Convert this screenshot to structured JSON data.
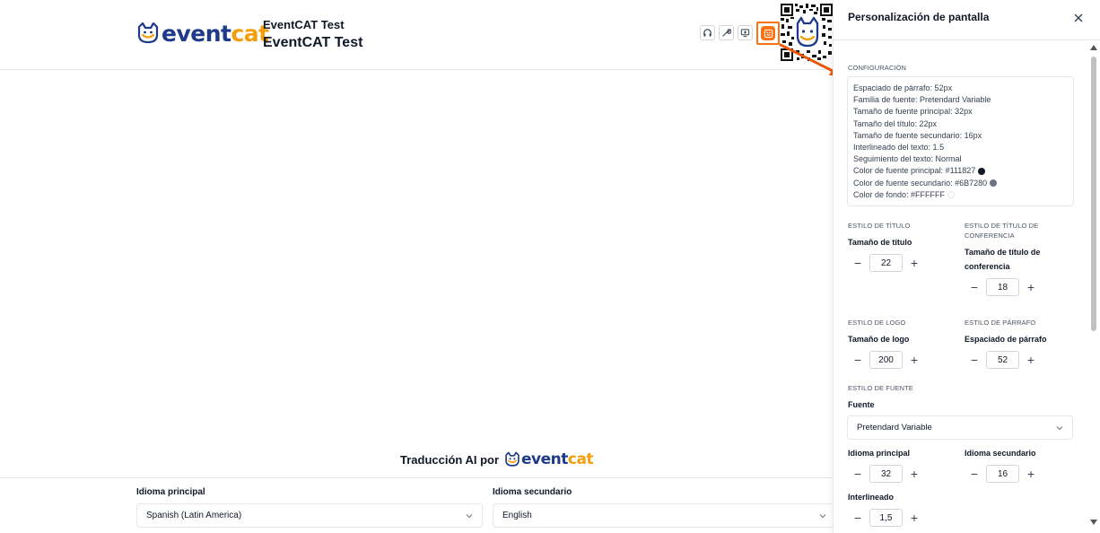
{
  "header": {
    "logo_text_part1": "event",
    "logo_text_part2": "cat",
    "event_name_small": "EventCAT Test",
    "event_name_large": "EventCAT Test",
    "icons": [
      "headphones-icon",
      "wrench-icon",
      "screen-download-icon",
      "screen-customize-icon"
    ],
    "accent_color": "#f97316"
  },
  "translation": {
    "powered_by": "Traducción AI por",
    "logo_text_part1": "event",
    "logo_text_part2": "cat",
    "primary_language_label": "Idioma principal",
    "primary_language_value": "Spanish (Latin America)",
    "secondary_language_label": "Idioma secundario",
    "secondary_language_value": "English"
  },
  "panel": {
    "title": "Personalización de pantalla",
    "config_section": "CONFIGURACIÓN",
    "config_lines": [
      {
        "text": "Espaciado de párrafo: 52px",
        "dot": null
      },
      {
        "text": "Familia de fuente: Pretendard Variable",
        "dot": null
      },
      {
        "text": "Tamaño de fuente principal: 32px",
        "dot": null
      },
      {
        "text": "Tamaño del título: 22px",
        "dot": null
      },
      {
        "text": "Tamaño de fuente secundario: 16px",
        "dot": null
      },
      {
        "text": "Interlineado del texto: 1.5",
        "dot": null
      },
      {
        "text": "Seguimiento del texto: Normal",
        "dot": null
      },
      {
        "text": "Color de fuente principal: #111827",
        "dot": "#111827"
      },
      {
        "text": "Color de fuente secundario: #6B7280",
        "dot": "#6B7280"
      },
      {
        "text": "Color de fondo: #FFFFFF",
        "dot": "#FFFFFF"
      }
    ],
    "title_style_section": "ESTILO DE TÍTULO",
    "title_size_label": "Tamaño de título",
    "title_size_value": "22",
    "conf_title_section_line1": "ESTILO DE TÍTULO DE",
    "conf_title_section_line2": "CONFERENCIA",
    "conf_title_size_label_line1": "Tamaño de título de",
    "conf_title_size_label_line2": "conferencia",
    "conf_title_size_value": "18",
    "logo_style_section": "ESTILO DE LOGO",
    "logo_size_label": "Tamaño de logo",
    "logo_size_value": "200",
    "paragraph_style_section": "ESTILO DE PÁRRAFO",
    "paragraph_spacing_label": "Espaciado de párrafo",
    "paragraph_spacing_value": "52",
    "font_style_section": "ESTILO DE FUENTE",
    "font_label": "Fuente",
    "font_value": "Pretendard Variable",
    "primary_lang_label": "Idioma principal",
    "primary_lang_value": "32",
    "secondary_lang_label": "Idioma secundario",
    "secondary_lang_value": "16",
    "line_height_label": "Interlineado",
    "line_height_value": "1,5"
  }
}
